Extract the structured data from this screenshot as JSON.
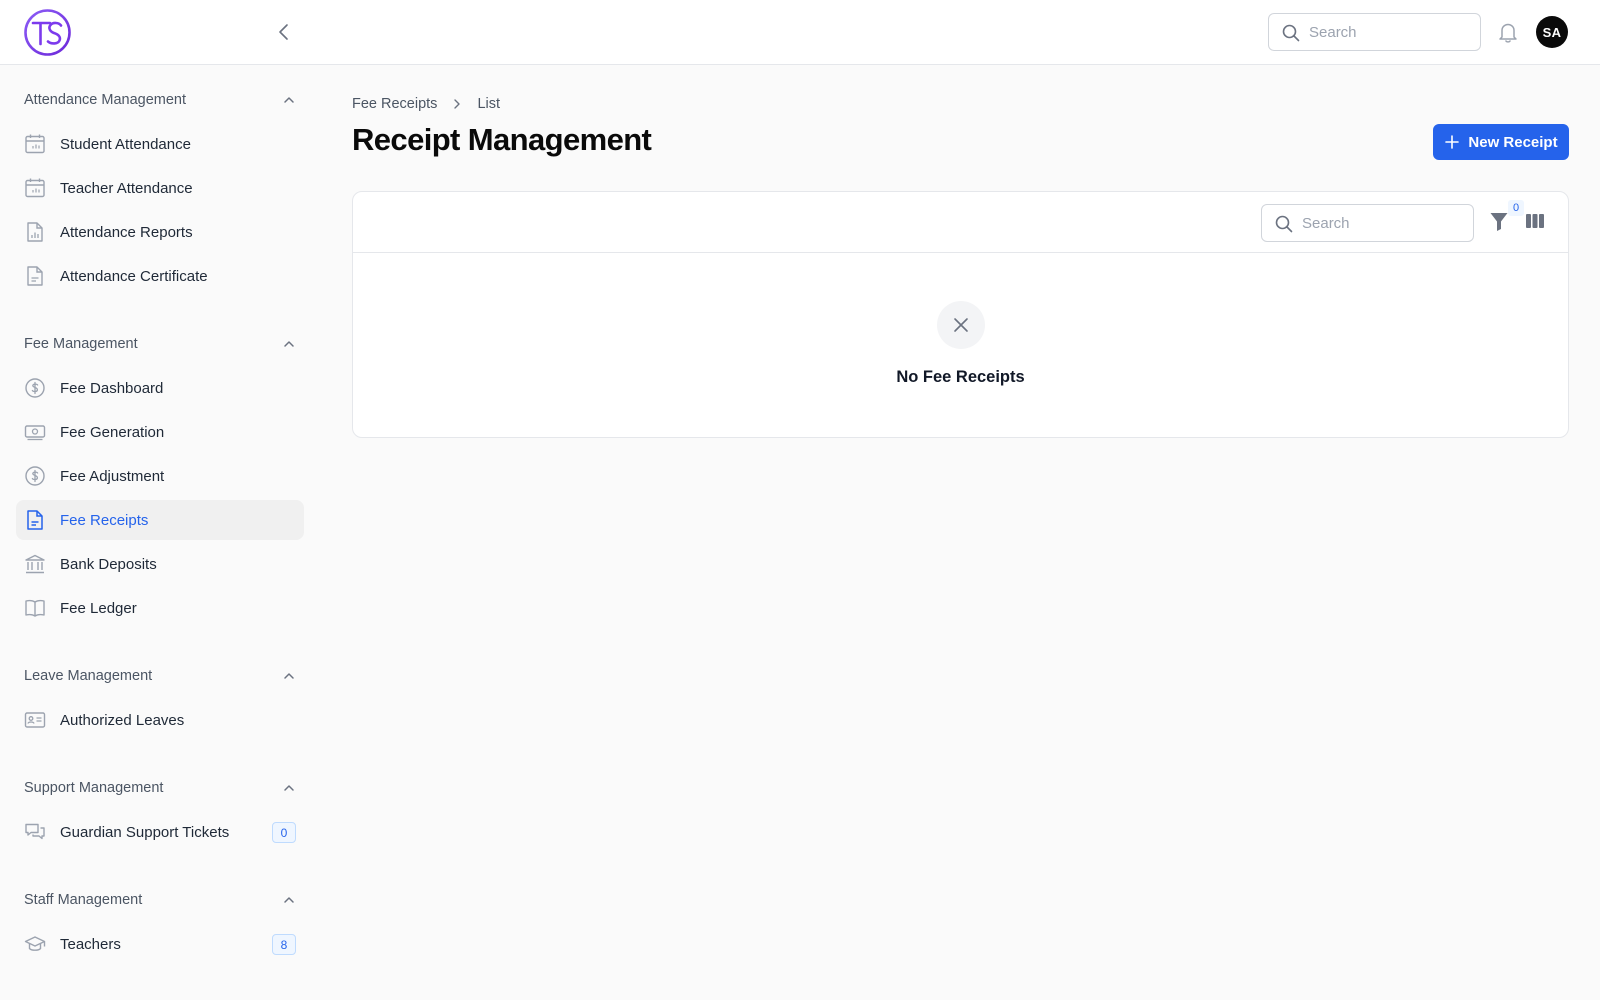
{
  "header": {
    "search_placeholder": "Search",
    "avatar_initials": "SA"
  },
  "sidebar": {
    "groups": [
      {
        "title": "Attendance Management",
        "items": [
          {
            "label": "Student Attendance",
            "icon": "calendar-icon"
          },
          {
            "label": "Teacher Attendance",
            "icon": "calendar-icon"
          },
          {
            "label": "Attendance Reports",
            "icon": "report-icon"
          },
          {
            "label": "Attendance Certificate",
            "icon": "document-icon"
          }
        ]
      },
      {
        "title": "Fee Management",
        "items": [
          {
            "label": "Fee Dashboard",
            "icon": "dollar-circle-icon"
          },
          {
            "label": "Fee Generation",
            "icon": "banknote-icon"
          },
          {
            "label": "Fee Adjustment",
            "icon": "dollar-circle-icon"
          },
          {
            "label": "Fee Receipts",
            "icon": "document-icon",
            "active": true
          },
          {
            "label": "Bank Deposits",
            "icon": "bank-icon"
          },
          {
            "label": "Fee Ledger",
            "icon": "book-icon"
          }
        ]
      },
      {
        "title": "Leave Management",
        "items": [
          {
            "label": "Authorized Leaves",
            "icon": "id-card-icon"
          }
        ]
      },
      {
        "title": "Support Management",
        "items": [
          {
            "label": "Guardian Support Tickets",
            "icon": "chat-icon",
            "badge": "0"
          }
        ]
      },
      {
        "title": "Staff Management",
        "items": [
          {
            "label": "Teachers",
            "icon": "graduation-cap-icon",
            "badge": "8"
          }
        ]
      }
    ]
  },
  "main": {
    "breadcrumb": [
      "Fee Receipts",
      "List"
    ],
    "title": "Receipt Management",
    "new_button_label": "New Receipt",
    "table": {
      "search_placeholder": "Search",
      "filter_count": "0",
      "empty_message": "No Fee Receipts"
    }
  },
  "colors": {
    "accent": "#2563eb",
    "logo": "#7c3aed",
    "active_bg": "#f0f0f0"
  }
}
